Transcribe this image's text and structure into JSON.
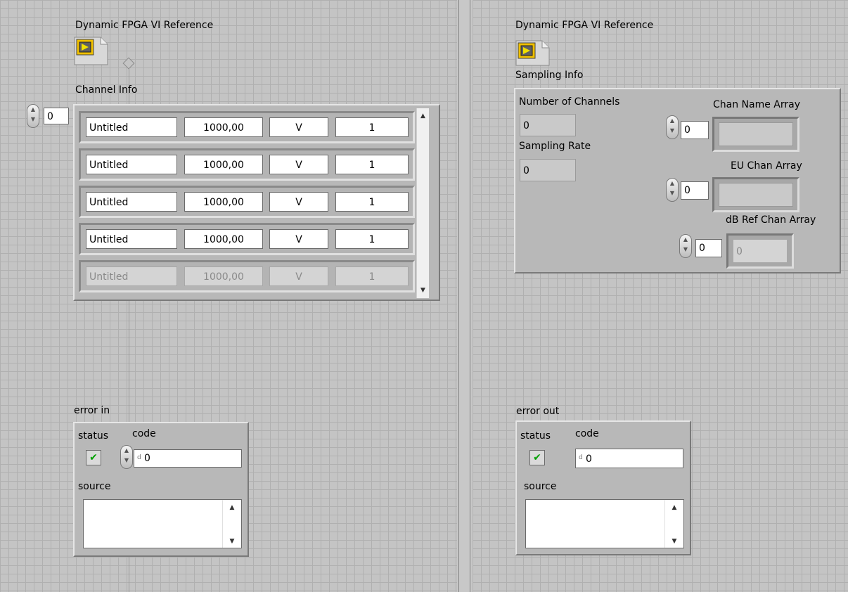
{
  "left": {
    "fpga_ref_label": "Dynamic FPGA VI Reference",
    "channel_info_label": "Channel Info",
    "index_value": "0",
    "rows": [
      {
        "name": "Untitled",
        "rate": "1000,00",
        "unit": "V",
        "scale": "1",
        "dim": false
      },
      {
        "name": "Untitled",
        "rate": "1000,00",
        "unit": "V",
        "scale": "1",
        "dim": false
      },
      {
        "name": "Untitled",
        "rate": "1000,00",
        "unit": "V",
        "scale": "1",
        "dim": false
      },
      {
        "name": "Untitled",
        "rate": "1000,00",
        "unit": "V",
        "scale": "1",
        "dim": false
      },
      {
        "name": "Untitled",
        "rate": "1000,00",
        "unit": "V",
        "scale": "1",
        "dim": true
      }
    ],
    "error": {
      "title": "error in",
      "status_label": "status",
      "code_label": "code",
      "code_value": "0",
      "source_label": "source",
      "status_glyph": "✔"
    }
  },
  "right": {
    "fpga_ref_label": "Dynamic FPGA VI Reference",
    "sampling_info_label": "Sampling Info",
    "num_channels_label": "Number of Channels",
    "num_channels_value": "0",
    "sampling_rate_label": "Sampling Rate",
    "sampling_rate_value": "0",
    "chan_name_array_label": "Chan Name Array",
    "chan_name_index": "0",
    "eu_chan_array_label": "EU Chan Array",
    "eu_chan_index": "0",
    "db_ref_chan_array_label": "dB Ref Chan Array",
    "db_ref_index": "0",
    "db_ref_value": "0",
    "error": {
      "title": "error out",
      "status_label": "status",
      "code_label": "code",
      "code_value": "0",
      "source_label": "source",
      "status_glyph": "✔"
    }
  },
  "icons": {
    "fpga": "fpga-reference-icon",
    "spinner_glyph": "▲▼",
    "scroll_up": "▲",
    "scroll_down": "▼",
    "d_marker": "d"
  }
}
